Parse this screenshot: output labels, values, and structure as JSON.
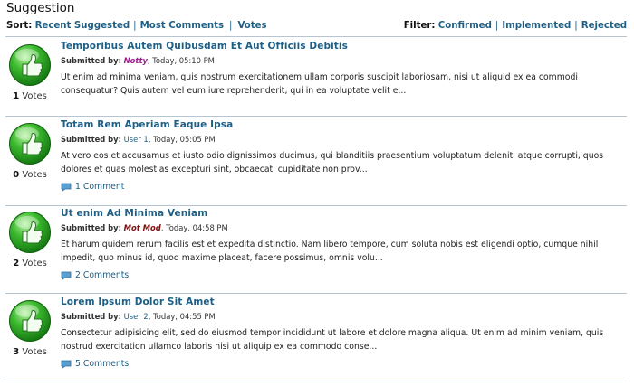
{
  "page": {
    "title": "Suggestion"
  },
  "toolbar": {
    "sort_label": "Sort:",
    "sort_links": [
      "Recent Suggested",
      "Most Comments",
      "Votes"
    ],
    "filter_label": "Filter:",
    "filter_links": [
      "Confirmed",
      "Implemented",
      "Rejected"
    ]
  },
  "items": [
    {
      "votes_count": "1",
      "votes_label": "Votes",
      "title": "Temporibus Autem Quibusdam Et Aut Officiis Debitis",
      "submitted_label": "Submitted by:",
      "author": "Notty",
      "date": ", Today, 05:10 PM",
      "text": "Ut enim ad minima veniam, quis nostrum exercitationem ullam corporis suscipit laboriosam, nisi ut aliquid ex ea commodi consequatur? Quis autem vel eum iure reprehenderit, qui in ea voluptate velit e...",
      "comments": ""
    },
    {
      "votes_count": "0",
      "votes_label": "Votes",
      "title": "Totam Rem Aperiam Eaque Ipsa",
      "submitted_label": "Submitted by:",
      "author": "User 1",
      "date": ", Today, 05:05 PM",
      "text": "At vero eos et accusamus et iusto odio dignissimos ducimus, qui blanditiis praesentium voluptatum deleniti atque corrupti, quos dolores et quas molestias excepturi sint, obcaecati cupiditate non prov...",
      "comments": "1 Comment"
    },
    {
      "votes_count": "2",
      "votes_label": "Votes",
      "title": "Ut enim Ad Minima Veniam",
      "submitted_label": "Submitted by:",
      "author": "Mot Mod",
      "date": ", Today, 04:58 PM",
      "text": "Et harum quidem rerum facilis est et expedita distinctio. Nam libero tempore, cum soluta nobis est eligendi optio, cumque nihil impedit, quo minus id, quod maxime placeat, facere possimus, omnis volu...",
      "comments": "2 Comments"
    },
    {
      "votes_count": "3",
      "votes_label": "Votes",
      "title": "Lorem Ipsum Dolor Sit Amet",
      "submitted_label": "Submitted by:",
      "author": "User 2",
      "date": ", Today, 04:55 PM",
      "text": "Consectetur adipisicing elit, sed do eiusmod tempor incididunt ut labore et dolore magna aliqua. Ut enim ad minim veniam, quis nostrud exercitation ullamco laboris nisi ut aliquip ex ea commodo conse...",
      "comments": "5 Comments"
    }
  ],
  "colors": {
    "link": "#1d5f86",
    "vote_green": "#2fa52a",
    "mod_name": "#7a0f0f",
    "admin_name": "#a01f8f"
  },
  "icons": {
    "vote": "thumbs-up-icon",
    "comment": "speech-bubble-icon"
  }
}
